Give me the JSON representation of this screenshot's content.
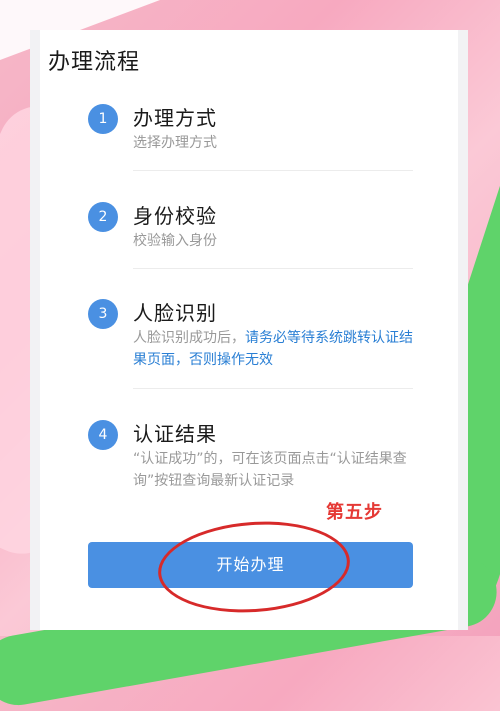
{
  "page": {
    "title": "办理流程"
  },
  "steps": [
    {
      "number": "1",
      "title": "办理方式",
      "description": "选择办理方式"
    },
    {
      "number": "2",
      "title": "身份校验",
      "description": "校验输入身份"
    },
    {
      "number": "3",
      "title": "人脸识别",
      "description_prefix": "人脸识别成功后，",
      "description_highlight": "请务必等待系统跳转认证结果页面，否则操作无效"
    },
    {
      "number": "4",
      "title": "认证结果",
      "description": "“认证成功”的，可在该页面点击“认证结果查询”按钮查询最新认证记录"
    }
  ],
  "annotation": {
    "label": "第五步",
    "color": "#e53935"
  },
  "actions": {
    "start_label": "开始办理"
  },
  "colors": {
    "accent": "#4a90e2",
    "highlight_text": "#2a7fd4"
  }
}
